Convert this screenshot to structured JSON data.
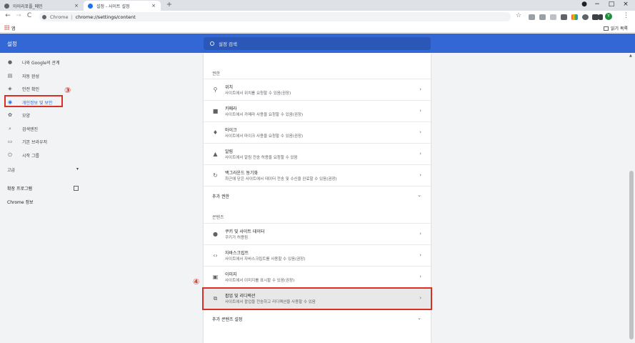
{
  "browser": {
    "tabs": [
      {
        "title": "아이리포플_메인",
        "close": "×"
      },
      {
        "title": "설정 - 사이트 설정",
        "close": "×"
      }
    ],
    "new_tab": "+",
    "window_controls": {
      "minimize": "−",
      "maximize": "□",
      "close": "×"
    },
    "nav": {
      "back": "←",
      "forward": "→",
      "reload": "C"
    },
    "url": {
      "scheme": "Chrome",
      "separator": "|",
      "path": "chrome://settings/content"
    },
    "bookmark_star": "☆",
    "avatar_letter": "Y",
    "menu": "⋮",
    "bookmarks_bar": {
      "apps_label": "앱",
      "reading_list": "읽기 목록"
    }
  },
  "header": {
    "title": "설정",
    "search_placeholder": "설정 검색"
  },
  "sidebar": {
    "items": [
      {
        "label": "나와 Google의 관계",
        "icon": "person-icon"
      },
      {
        "label": "자동 완성",
        "icon": "clipboard-icon"
      },
      {
        "label": "안전 확인",
        "icon": "shield-icon"
      },
      {
        "label": "개인정보 및 보안",
        "icon": "shield-lock-icon",
        "active": true
      },
      {
        "label": "모양",
        "icon": "palette-icon"
      },
      {
        "label": "검색엔진",
        "icon": "search-icon"
      },
      {
        "label": "기본 브라우저",
        "icon": "browser-icon"
      },
      {
        "label": "시작 그룹",
        "icon": "power-icon"
      }
    ],
    "advanced": "고급",
    "advanced_caret": "▾",
    "extensions": "확장 프로그램",
    "about": "Chrome 정보"
  },
  "annotations": {
    "marker3": "③",
    "marker4": "④"
  },
  "permissions": {
    "title": "권한",
    "rows": [
      {
        "title": "위치",
        "desc": "사이트에서 위치를 요청할 수 있음(권장)",
        "icon": "location-icon"
      },
      {
        "title": "카메라",
        "desc": "사이트에서 카메라 사용을 요청할 수 있음(권장)",
        "icon": "camera-icon"
      },
      {
        "title": "마이크",
        "desc": "사이트에서 마이크 사용을 요청할 수 있음(권장)",
        "icon": "mic-icon"
      },
      {
        "title": "알림",
        "desc": "사이트에서 알림 전송 허용을 요청할 수 있음",
        "icon": "bell-icon"
      },
      {
        "title": "백그라운드 동기화",
        "desc": "최근에 닫은 사이트에서 데이터 전송 및 수신을 완료할 수 있음(권장)",
        "icon": "sync-icon"
      }
    ],
    "more": "추가 권한"
  },
  "content": {
    "title": "콘텐츠",
    "rows": [
      {
        "title": "쿠키 및 사이트 데이터",
        "desc": "쿠키가 허용됨",
        "icon": "cookie-icon"
      },
      {
        "title": "자바스크립트",
        "desc": "사이트에서 자바스크립트를 사용할 수 있음(권장)",
        "icon": "code-icon"
      },
      {
        "title": "이미지",
        "desc": "사이트에서 이미지를 표시할 수 있음(권장)",
        "icon": "image-icon"
      },
      {
        "title": "팝업 및 리디렉션",
        "desc": "사이트에서 팝업을 전송하고 리디렉션을 사용할 수 있음",
        "icon": "popup-icon"
      }
    ],
    "more": "추가 콘텐츠 설정"
  },
  "glyphs": {
    "chevron": "›",
    "caret": "⌄",
    "scroll_up": "▲"
  },
  "colors": {
    "header": "#3367d6",
    "accent": "#1a73e8",
    "annotation": "#d93025"
  }
}
